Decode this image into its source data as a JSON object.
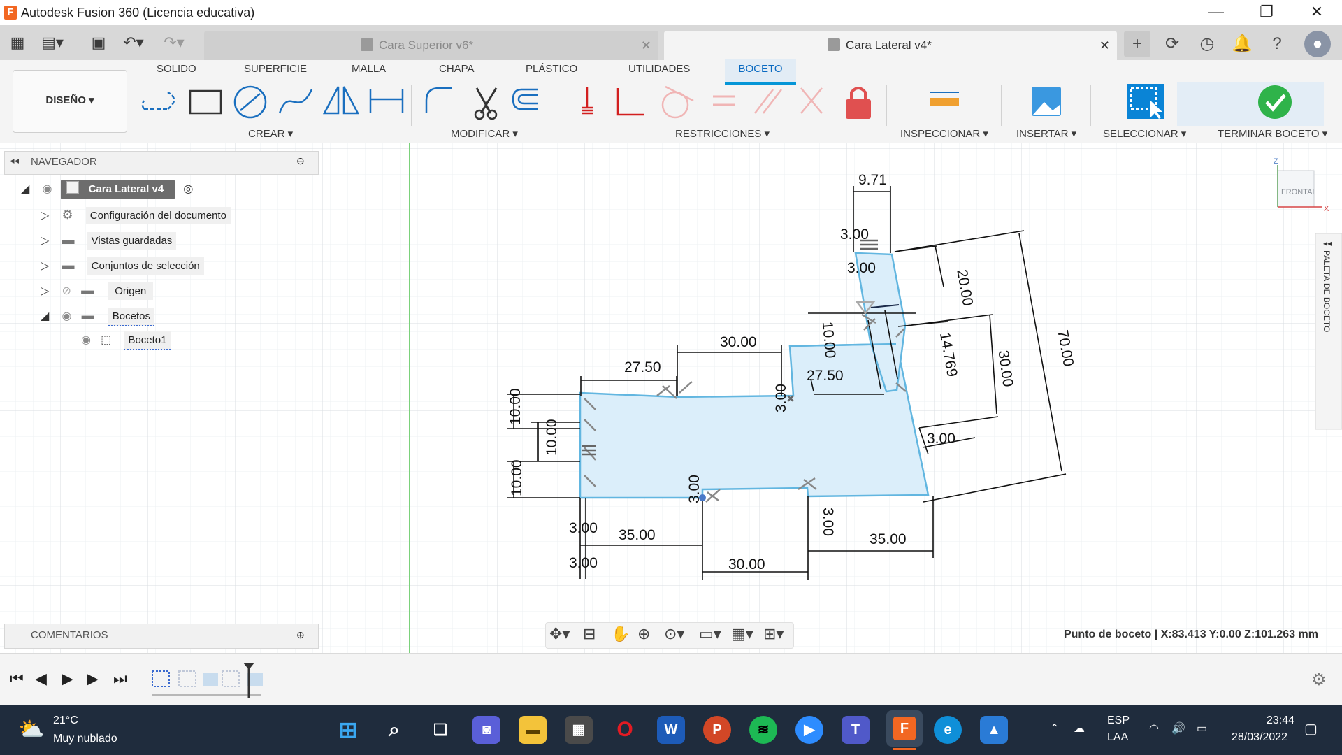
{
  "window": {
    "title": "Autodesk Fusion 360 (Licencia educativa)",
    "app_logo": "F",
    "controls": [
      "—",
      "❐",
      "✕"
    ]
  },
  "tabs": [
    {
      "label": "Cara Superior v6*",
      "active": false
    },
    {
      "label": "Cara Lateral v4*",
      "active": true
    }
  ],
  "toolbar_icons": [
    "grid-icon",
    "file-icon",
    "save-icon",
    "undo-icon",
    "redo-icon",
    "plus-icon",
    "refresh-icon",
    "clock-icon",
    "bell-icon",
    "help-icon",
    "avatar-icon"
  ],
  "ribbon": {
    "tabs": [
      "SOLIDO",
      "SUPERFICIE",
      "MALLA",
      "CHAPA",
      "PLÁSTICO",
      "UTILIDADES",
      "BOCETO"
    ],
    "active_tab": "BOCETO",
    "workspace": "DISEÑO ▾",
    "groups": [
      "CREAR ▾",
      "MODIFICAR ▾",
      "RESTRICCIONES ▾",
      "INSPECCIONAR ▾",
      "INSERTAR ▾",
      "SELECCIONAR ▾",
      "TERMINAR BOCETO ▾"
    ]
  },
  "navigator": {
    "title": "NAVEGADOR",
    "root": "Cara Lateral v4",
    "items": [
      {
        "label": "Configuración del documento",
        "icon": "gear-icon"
      },
      {
        "label": "Vistas guardadas",
        "icon": "folder-icon"
      },
      {
        "label": "Conjuntos de selección",
        "icon": "folder-icon"
      },
      {
        "label": "Origen",
        "icon": "folder-icon"
      },
      {
        "label": "Bocetos",
        "icon": "folder-icon"
      },
      {
        "label": "Boceto1",
        "icon": "sketch-icon"
      }
    ]
  },
  "comments": {
    "title": "COMENTARIOS"
  },
  "viewcube": {
    "label": "FRONTAL",
    "axis_z": "Z",
    "axis_x": "X"
  },
  "palette": {
    "label": "PALETA DE BOCETO"
  },
  "status": {
    "text": "Punto de boceto | X:83.413 Y:0.00 Z:101.263 mm"
  },
  "dimensions": [
    "9.71",
    "3.00",
    "3.00",
    "20.00",
    "70.00",
    "10.00",
    "14.769",
    "30.00",
    "30.00",
    "27.50",
    "27.50",
    "3.00",
    "3.00",
    "10.00",
    "10.00",
    "10.00",
    "3.00",
    "3.00",
    "3.00",
    "35.00",
    "35.00",
    "30.00",
    "3.00"
  ],
  "taskbar": {
    "weather_temp": "21°C",
    "weather_desc": "Muy nublado",
    "lang_top": "ESP",
    "lang_bottom": "LAA",
    "time": "23:44",
    "date": "28/03/2022"
  },
  "colors": {
    "accent": "#0696d7",
    "sketch_line": "#62b6e0",
    "sketch_fill": "#dbeefa",
    "taskbar": "#1f2c3d"
  }
}
